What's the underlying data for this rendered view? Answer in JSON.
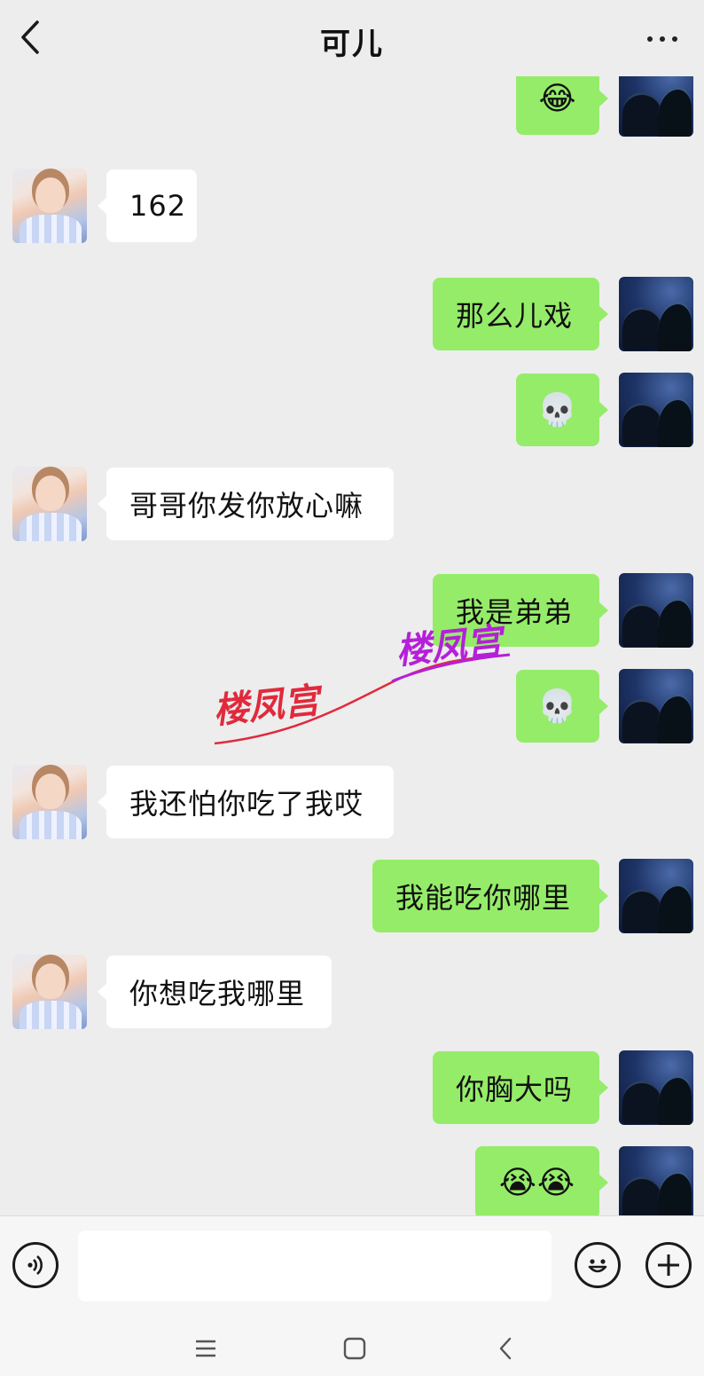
{
  "header": {
    "title": "可儿"
  },
  "messages": [
    {
      "side": "right",
      "text": "😂",
      "type": "emoji"
    },
    {
      "side": "left",
      "text": "162",
      "type": "text"
    },
    {
      "side": "right",
      "text": "那么儿戏",
      "type": "text"
    },
    {
      "side": "right",
      "text": "💀",
      "type": "emoji"
    },
    {
      "side": "left",
      "text": "哥哥你发你放心嘛",
      "type": "text"
    },
    {
      "side": "right",
      "text": "我是弟弟",
      "type": "text"
    },
    {
      "side": "right",
      "text": "💀",
      "type": "emoji"
    },
    {
      "side": "left",
      "text": "我还怕你吃了我哎",
      "type": "text"
    },
    {
      "side": "right",
      "text": "我能吃你哪里",
      "type": "text"
    },
    {
      "side": "left",
      "text": "你想吃我哪里",
      "type": "text"
    },
    {
      "side": "right",
      "text": "你胸大吗",
      "type": "text"
    },
    {
      "side": "right",
      "text": "😭😭",
      "type": "emoji"
    }
  ],
  "watermark": {
    "text1": "楼凤宫",
    "text2": "楼凤宫",
    "color1": "#e02a3c",
    "color2": "#b420d8"
  },
  "input": {
    "value": "",
    "placeholder": ""
  },
  "colors": {
    "background": "#ededed",
    "sent_bubble": "#95ec69",
    "received_bubble": "#ffffff"
  }
}
